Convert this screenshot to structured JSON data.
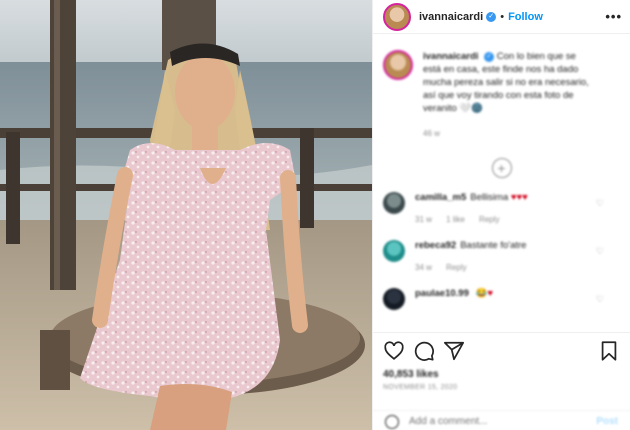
{
  "post": {
    "username": "ivannaicardi",
    "follow_label": "Follow",
    "dot": "•",
    "more_label": "•••",
    "verified_glyph": "✓",
    "caption_username": "ivannaicardi",
    "caption_text": "Con lo bien que se está en casa, este finde nos ha dado mucha pereza salir si no era necesario, así que voy tirando con esta foto de veranito 🤍🌚",
    "caption_time": "46 w",
    "load_more_glyph": "+",
    "comments": [
      {
        "username": "camilla_m5",
        "text": "Bellisima",
        "hearts": "♥♥♥",
        "time": "31 w",
        "likes": "1 like",
        "reply": "Reply"
      },
      {
        "username": "rebeca92",
        "text": "Bastante fo'atre",
        "hearts": "",
        "time": "34 w",
        "likes": "",
        "reply": "Reply"
      },
      {
        "username": "paulae10.99",
        "text": "",
        "hearts": "😂♥",
        "time": "",
        "likes": "",
        "reply": ""
      }
    ],
    "comment_like_glyph": "♡",
    "likes_text": "40,853 likes",
    "date_text": "NOVEMBER 15, 2020",
    "add_comment_placeholder": "Add a comment...",
    "post_label": "Post"
  },
  "icons": [
    "heart-icon",
    "comment-icon",
    "share-icon",
    "bookmark-icon",
    "emoji-icon"
  ],
  "colors": {
    "accent": "#0095f6",
    "verified": "#3897f0",
    "heart": "#d0021b",
    "muted": "#8e8e8e"
  }
}
